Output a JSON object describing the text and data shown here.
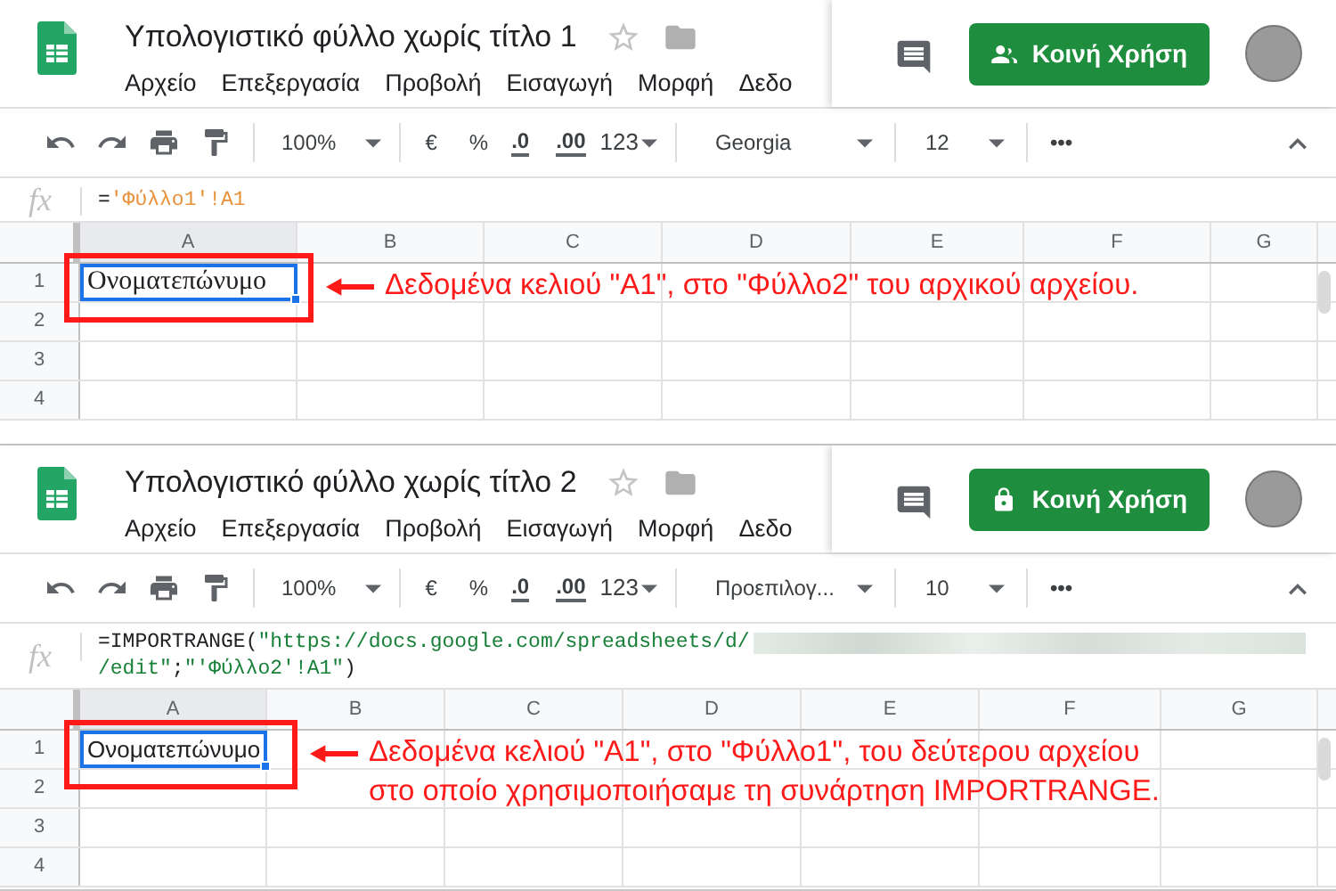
{
  "panels": [
    {
      "title": "Υπολογιστικό φύλλο χωρίς τίτλο 1",
      "starred": false,
      "menu": [
        "Αρχείο",
        "Επεξεργασία",
        "Προβολή",
        "Εισαγωγή",
        "Μορφή",
        "Δεδο"
      ],
      "share_button": {
        "label": "Κοινή Χρήση",
        "kind": "people"
      },
      "toolbar": {
        "zoom": "100%",
        "currency": "€",
        "percent": "%",
        "decrease_decimals": ".0",
        "increase_decimals": ".00",
        "number_format": "123",
        "font": "Georgia",
        "font_size": "12",
        "more": "•••"
      },
      "formula": {
        "fx": "fx",
        "lines": [
          [
            {
              "kind": "plain",
              "text": "="
            },
            {
              "kind": "reference",
              "text": "'Φύλλο1'!A1"
            }
          ]
        ]
      },
      "sheet": {
        "columns": [
          "A",
          "B",
          "C",
          "D",
          "E",
          "F",
          "G"
        ],
        "rows": [
          "1",
          "2",
          "3",
          "4"
        ],
        "cell_a1": "Ονοματεπώνυμο"
      },
      "annotation": [
        "Δεδομένα κελιού \"A1\", στο \"Φύλλο2\" του αρχικού αρχείου."
      ]
    },
    {
      "title": "Υπολογιστικό φύλλο χωρίς τίτλο 2",
      "starred": false,
      "menu": [
        "Αρχείο",
        "Επεξεργασία",
        "Προβολή",
        "Εισαγωγή",
        "Μορφή",
        "Δεδο"
      ],
      "share_button": {
        "label": "Κοινή Χρήση",
        "kind": "lock"
      },
      "toolbar": {
        "zoom": "100%",
        "currency": "€",
        "percent": "%",
        "decrease_decimals": ".0",
        "increase_decimals": ".00",
        "number_format": "123",
        "font": "Προεπιλογ...",
        "font_size": "10",
        "more": "•••"
      },
      "formula": {
        "fx": "fx",
        "lines": [
          [
            {
              "kind": "plain",
              "text": "=IMPORTRANGE("
            },
            {
              "kind": "string",
              "text": "\"https://docs.google.com/spreadsheets/d/"
            },
            {
              "kind": "redacted"
            }
          ],
          [
            {
              "kind": "string",
              "text": "/edit\""
            },
            {
              "kind": "plain",
              "text": ";"
            },
            {
              "kind": "string",
              "text": "\"'Φύλλο2'!A1\""
            },
            {
              "kind": "plain",
              "text": ")"
            }
          ]
        ]
      },
      "sheet": {
        "columns": [
          "A",
          "B",
          "C",
          "D",
          "E",
          "F",
          "G"
        ],
        "rows": [
          "1",
          "2",
          "3",
          "4"
        ],
        "cell_a1": "Ονοματεπώνυμο"
      },
      "annotation": [
        "Δεδομένα κελιού \"A1\", στο \"Φύλλο1\", του δεύτερου αρχείου",
        "στο οποίο χρησιμοποιήσαμε τη συνάρτηση IMPORTRANGE."
      ]
    }
  ]
}
